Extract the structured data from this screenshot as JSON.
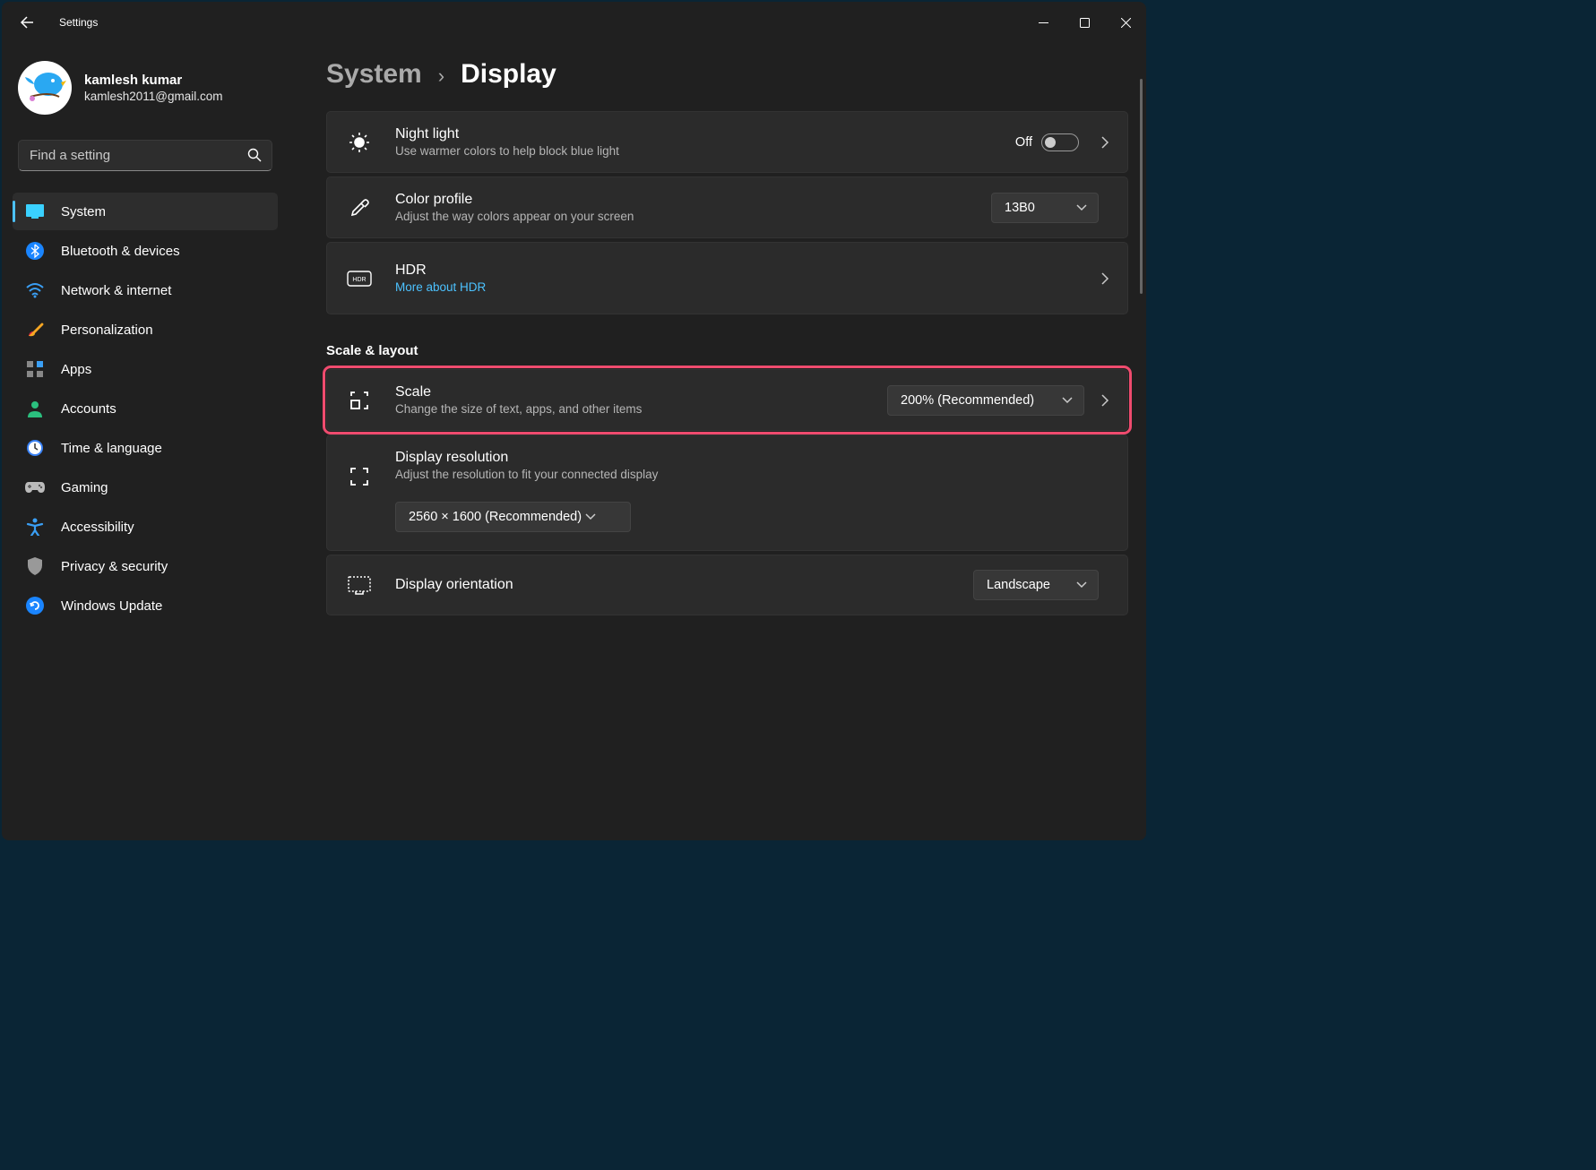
{
  "window": {
    "title": "Settings"
  },
  "profile": {
    "name": "kamlesh kumar",
    "email": "kamlesh2011@gmail.com"
  },
  "search": {
    "placeholder": "Find a setting"
  },
  "nav": {
    "items": [
      {
        "label": "System",
        "icon": "system",
        "selected": true
      },
      {
        "label": "Bluetooth & devices",
        "icon": "bluetooth"
      },
      {
        "label": "Network & internet",
        "icon": "wifi"
      },
      {
        "label": "Personalization",
        "icon": "brush"
      },
      {
        "label": "Apps",
        "icon": "apps"
      },
      {
        "label": "Accounts",
        "icon": "person"
      },
      {
        "label": "Time & language",
        "icon": "clock"
      },
      {
        "label": "Gaming",
        "icon": "gamepad"
      },
      {
        "label": "Accessibility",
        "icon": "accessibility"
      },
      {
        "label": "Privacy & security",
        "icon": "shield"
      },
      {
        "label": "Windows Update",
        "icon": "update"
      }
    ]
  },
  "breadcrumb": {
    "parent": "System",
    "current": "Display"
  },
  "cards": {
    "night_light": {
      "title": "Night light",
      "sub": "Use warmer colors to help block blue light",
      "toggle_label": "Off"
    },
    "color_profile": {
      "title": "Color profile",
      "sub": "Adjust the way colors appear on your screen",
      "value": "13B0"
    },
    "hdr": {
      "title": "HDR",
      "link": "More about HDR"
    },
    "scale_section": "Scale & layout",
    "scale": {
      "title": "Scale",
      "sub": "Change the size of text, apps, and other items",
      "value": "200% (Recommended)"
    },
    "resolution": {
      "title": "Display resolution",
      "sub": "Adjust the resolution to fit your connected display",
      "value": "2560 × 1600 (Recommended)"
    },
    "orientation": {
      "title": "Display orientation",
      "value": "Landscape"
    }
  }
}
